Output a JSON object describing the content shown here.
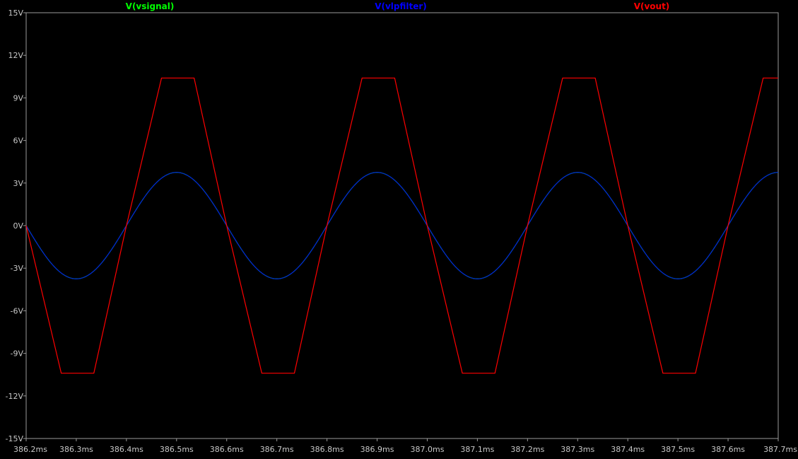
{
  "chart_data": {
    "type": "line",
    "title": "",
    "xlabel": "",
    "ylabel": "",
    "x_unit": "ms",
    "y_unit": "V",
    "xlim": [
      386.2,
      387.7
    ],
    "ylim": [
      -15,
      15
    ],
    "grid": false,
    "legend_placement": "top",
    "x_ticks": [
      "386.2ms",
      "386.3ms",
      "386.4ms",
      "386.5ms",
      "386.6ms",
      "386.7ms",
      "386.8ms",
      "386.9ms",
      "387.0ms",
      "387.1ms",
      "387.2ms",
      "387.3ms",
      "387.4ms",
      "387.5ms",
      "387.6ms",
      "387.7ms"
    ],
    "y_ticks": [
      "15V",
      "12V",
      "9V",
      "6V",
      "3V",
      "0V",
      "-3V",
      "-6V",
      "-9V",
      "-12V",
      "-15V"
    ],
    "x_tick_values": [
      386.2,
      386.3,
      386.4,
      386.5,
      386.6,
      386.7,
      386.8,
      386.9,
      387.0,
      387.1,
      387.2,
      387.3,
      387.4,
      387.5,
      387.6,
      387.7
    ],
    "y_tick_values": [
      15,
      12,
      9,
      6,
      3,
      0,
      -3,
      -6,
      -9,
      -12,
      -15
    ],
    "series": [
      {
        "name": "V(vsignal)",
        "color": "#00ff00",
        "x": [
          386.2,
          386.25,
          386.3,
          386.35,
          386.4,
          386.45,
          386.5,
          386.55,
          386.6,
          386.65,
          386.7,
          386.75,
          386.8,
          386.85,
          386.9,
          386.95,
          387.0,
          387.05,
          387.1,
          387.15,
          387.2,
          387.25,
          387.3,
          387.35,
          387.4,
          387.45,
          387.5,
          387.55,
          387.6,
          387.65,
          387.7
        ],
        "y": [
          0,
          -2.7,
          -3.75,
          -2.7,
          0,
          2.7,
          3.75,
          2.7,
          0,
          -2.7,
          -3.75,
          -2.7,
          0,
          2.7,
          3.75,
          2.7,
          0,
          -2.7,
          -3.75,
          -2.7,
          0,
          2.7,
          3.75,
          2.7,
          0,
          -2.7,
          -3.75,
          -2.7,
          0,
          2.7,
          3.75
        ]
      },
      {
        "name": "V(vlpfilter)",
        "color": "#0000ff",
        "x": [
          386.2,
          386.25,
          386.3,
          386.35,
          386.4,
          386.45,
          386.5,
          386.55,
          386.6,
          386.65,
          386.7,
          386.75,
          386.8,
          386.85,
          386.9,
          386.95,
          387.0,
          387.05,
          387.1,
          387.15,
          387.2,
          387.25,
          387.3,
          387.35,
          387.4,
          387.45,
          387.5,
          387.55,
          387.6,
          387.65,
          387.7
        ],
        "y": [
          0,
          -2.7,
          -3.75,
          -2.7,
          0,
          2.7,
          3.75,
          2.7,
          0,
          -2.7,
          -3.75,
          -2.7,
          0,
          2.7,
          3.75,
          2.7,
          0,
          -2.7,
          -3.75,
          -2.7,
          0,
          2.7,
          3.75,
          2.7,
          0,
          -2.7,
          -3.75,
          -2.7,
          0,
          2.7,
          3.75
        ]
      },
      {
        "name": "V(vout)",
        "color": "#ff0000",
        "x": [
          386.2,
          386.27,
          386.335,
          386.4,
          386.47,
          386.535,
          386.6,
          386.67,
          386.735,
          386.8,
          386.87,
          386.935,
          387.0,
          387.07,
          387.135,
          387.2,
          387.27,
          387.335,
          387.4,
          387.47,
          387.535,
          387.6,
          387.67,
          387.7
        ],
        "y": [
          0,
          -10.4,
          -10.4,
          0,
          10.4,
          10.4,
          0,
          -10.4,
          -10.4,
          0,
          10.4,
          10.4,
          0,
          -10.4,
          -10.4,
          0,
          10.4,
          10.4,
          0,
          -10.4,
          -10.4,
          0,
          10.4,
          10.4
        ]
      }
    ]
  }
}
